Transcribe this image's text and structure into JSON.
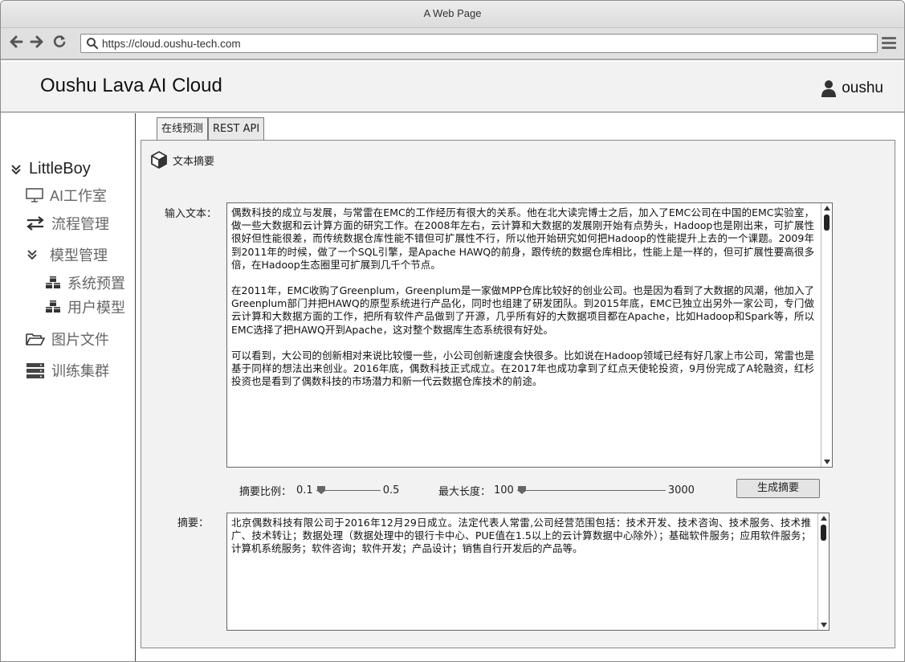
{
  "window": {
    "title": "A Web Page"
  },
  "browser": {
    "url": "https://cloud.oushu-tech.com",
    "back_icon": "back-arrow-icon",
    "forward_icon": "forward-arrow-icon",
    "reload_icon": "reload-icon"
  },
  "header": {
    "brand": "Oushu Lava AI Cloud",
    "user": "oushu"
  },
  "sidebar": {
    "root": "LittleBoy",
    "items": [
      {
        "label": "AI工作室",
        "icon": "monitor-icon"
      },
      {
        "label": "流程管理",
        "icon": "exchange-icon"
      },
      {
        "label": "模型管理",
        "icon": "chevron-double-down-icon"
      },
      {
        "label": "系统预置",
        "icon": "cubes-icon"
      },
      {
        "label": "用户模型",
        "icon": "cubes-icon"
      },
      {
        "label": "图片文件",
        "icon": "folder-open-icon"
      },
      {
        "label": "训练集群",
        "icon": "server-icon"
      }
    ]
  },
  "tabs": [
    {
      "label": "在线预测",
      "active": true
    },
    {
      "label": "REST API",
      "active": false
    }
  ],
  "panel": {
    "title": "文本摘要",
    "input_label": "输入文本：",
    "input_paragraphs": [
      "偶数科技的成立与发展，与常雷在EMC的工作经历有很大的关系。他在北大读完博士之后，加入了EMC公司在中国的EMC实验室，做一些大数据和云计算方面的研究工作。在2008年左右，云计算和大数据的发展刚开始有点势头，Hadoop也是刚出来，可扩展性很好但性能很差，而传统数据仓库性能不错但可扩展性不行，所以他开始研究如何把Hadoop的性能提升上去的一个课题。2009年到2011年的时候，做了一个SQL引擎，是Apache HAWQ的前身，跟传统的数据仓库相比，性能上是一样的，但可扩展性要高很多倍，在Hadoop生态圈里可扩展到几千个节点。",
      "在2011年，EMC收购了Greenplum，Greenplum是一家做MPP仓库比较好的创业公司。也是因为看到了大数据的风潮，他加入了Greenplum部门并把HAWQ的原型系统进行产品化，同时也组建了研发团队。到2015年底，EMC已独立出另外一家公司，专门做云计算和大数据方面的工作，把所有软件产品做到了开源，几乎所有好的大数据项目都在Apache，比如Hadoop和Spark等，所以EMC选择了把HAWQ开到Apache，这对整个数据库生态系统很有好处。",
      "可以看到，大公司的创新相对来说比较慢一些，小公司创新速度会快很多。比如说在Hadoop领域已经有好几家上市公司，常雷也是基于同样的想法出来创业。2016年底，偶数科技正式成立。在2017年也成功拿到了红点天使轮投资，9月份完成了A轮融资，红杉投资也是看到了偶数科技的市场潜力和新一代云数据仓库技术的前途。"
    ],
    "ratio": {
      "label": "摘要比例：",
      "min": "0.1",
      "max": "0.5",
      "value": 0.1
    },
    "maxlen": {
      "label": "最大长度：",
      "min": "100",
      "max": "3000",
      "value": 100
    },
    "generate_button": "生成摘要",
    "summary_label": "摘要：",
    "summary_text": "北京偶数科技有限公司于2016年12月29日成立。法定代表人常雷,公司经营范围包括：技术开发、技术咨询、技术服务、技术推广、技术转让；数据处理（数据处理中的银行卡中心、PUE值在1.5以上的云计算数据中心除外）；基础软件服务；应用软件服务；计算机系统服务；软件咨询；软件开发；产品设计；销售自行开发后的产品等。"
  }
}
